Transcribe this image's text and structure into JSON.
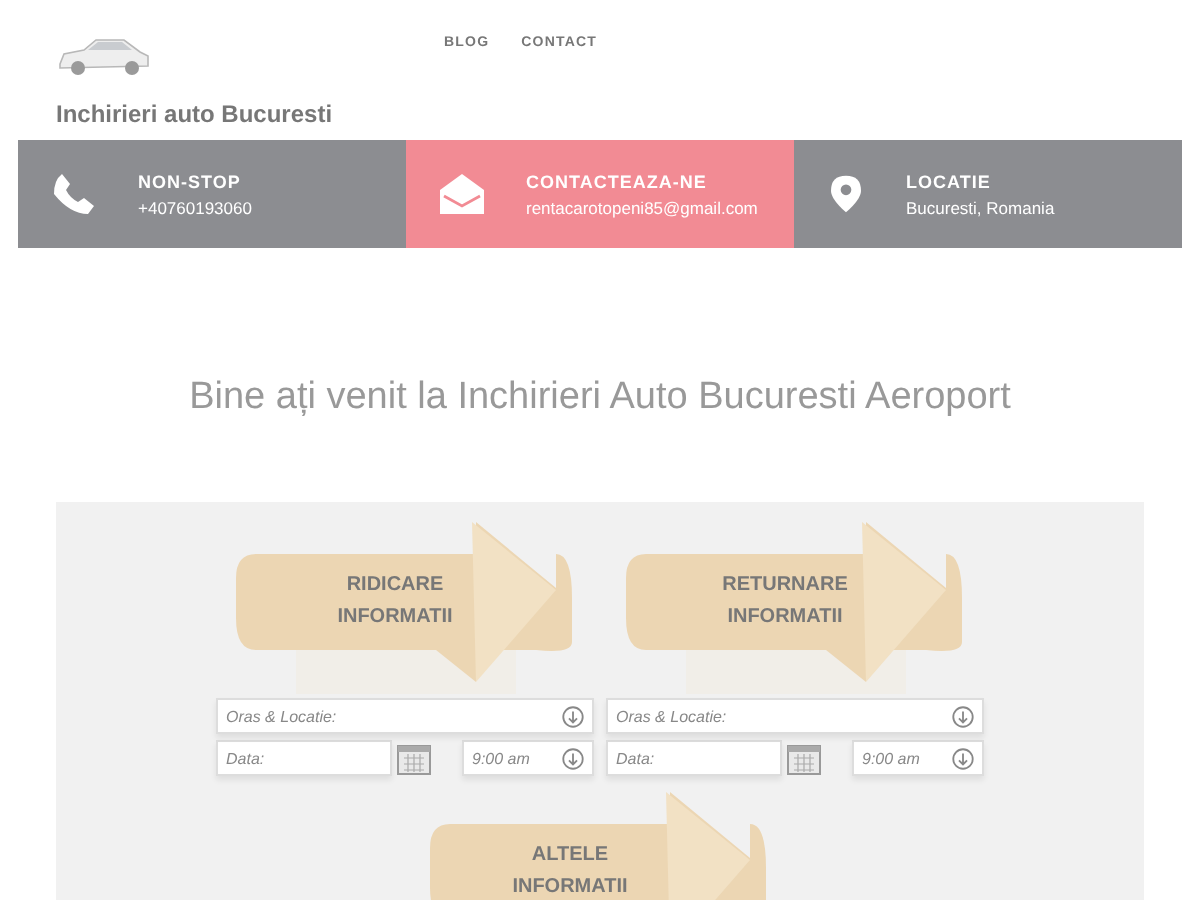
{
  "nav": [
    "BLOG",
    "CONTACT"
  ],
  "site_title": "Inchirieri auto Bucuresti",
  "contact_bar": [
    {
      "kind": "phone",
      "label": "NON-STOP",
      "value": "+40760193060",
      "color": "#8c8d91"
    },
    {
      "kind": "mail",
      "label": "CONTACTEAZA-NE",
      "value": "rentacarotopeni85@gmail.com",
      "color": "#f28b94"
    },
    {
      "kind": "location",
      "label": "LOCATIE",
      "value": "Bucuresti, Romania",
      "color": "#8c8d91"
    }
  ],
  "heading": "Bine ați venit la Inchirieri Auto Bucuresti Aeroport",
  "booking": [
    {
      "title": [
        "RIDICARE",
        "INFORMATII"
      ],
      "location_placeholder": "Oras & Locatie:",
      "date_placeholder": "Data:",
      "time": "9:00 am"
    },
    {
      "title": [
        "RETURNARE",
        "INFORMATII"
      ],
      "location_placeholder": "Oras & Locatie:",
      "date_placeholder": "Data:",
      "time": "9:00 am"
    }
  ],
  "other": {
    "title": [
      "ALTELE",
      "INFORMATII"
    ]
  }
}
